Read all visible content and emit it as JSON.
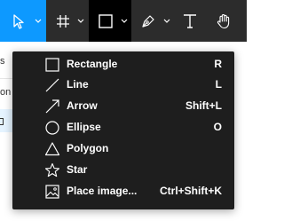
{
  "toolbar": {
    "tools": [
      {
        "name": "move-tool",
        "icon": "cursor-arrow-icon",
        "has_dropdown": true,
        "active": true
      },
      {
        "name": "frame-tool",
        "icon": "frame-hash-icon",
        "has_dropdown": true
      },
      {
        "name": "shape-tool",
        "icon": "rectangle-icon",
        "has_dropdown": true,
        "open": true
      },
      {
        "name": "pen-tool",
        "icon": "pen-nib-icon",
        "has_dropdown": true
      },
      {
        "name": "text-tool",
        "icon": "text-t-icon"
      },
      {
        "name": "hand-tool",
        "icon": "hand-icon"
      }
    ],
    "colors": {
      "bar": "#2c2c2c",
      "active": "#0d99ff",
      "open": "#000000",
      "icon": "#ffffff"
    }
  },
  "left_panel": {
    "fragments": [
      "s",
      "on"
    ]
  },
  "shape_menu": {
    "background": "#1e1e1e",
    "items": [
      {
        "icon": "rectangle-icon",
        "label": "Rectangle",
        "shortcut": "R"
      },
      {
        "icon": "line-icon",
        "label": "Line",
        "shortcut": "L"
      },
      {
        "icon": "arrow-icon",
        "label": "Arrow",
        "shortcut": "Shift+L"
      },
      {
        "icon": "ellipse-icon",
        "label": "Ellipse",
        "shortcut": "O"
      },
      {
        "icon": "polygon-icon",
        "label": "Polygon",
        "shortcut": ""
      },
      {
        "icon": "star-icon",
        "label": "Star",
        "shortcut": ""
      },
      {
        "icon": "image-icon",
        "label": "Place image...",
        "shortcut": "Ctrl+Shift+K"
      }
    ]
  }
}
